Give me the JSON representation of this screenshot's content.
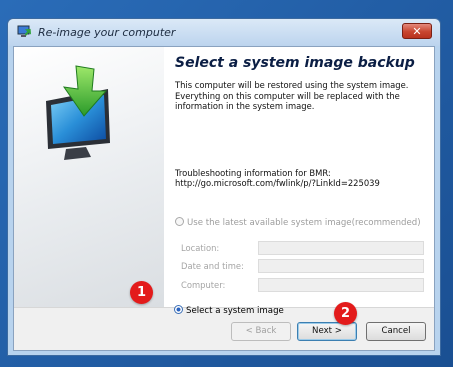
{
  "window": {
    "title": "Re-image your computer",
    "close_glyph": "✕"
  },
  "content": {
    "heading": "Select a system image backup",
    "description": "This computer will be restored using the system image. Everything on this computer will be replaced with the information in the system image.",
    "troubleshoot_line1": "Troubleshooting information for BMR:",
    "troubleshoot_line2": "http://go.microsoft.com/fwlink/p/?LinkId=225039",
    "option_latest": "Use the latest available system image(recommended)",
    "option_latest_selected": false,
    "option_latest_enabled": false,
    "fields": [
      {
        "label": "Location:",
        "value": ""
      },
      {
        "label": "Date and time:",
        "value": ""
      },
      {
        "label": "Computer:",
        "value": ""
      }
    ],
    "option_select": "Select a system image",
    "option_select_selected": true
  },
  "buttons": {
    "back": "< Back",
    "next": "Next >",
    "cancel": "Cancel",
    "back_enabled": false
  },
  "annotations": {
    "step1": "1",
    "step2": "2"
  },
  "colors": {
    "desktop": "#1f5fa8",
    "badge": "#e31b1b",
    "heading": "#0b1e44"
  },
  "icons": {
    "title": "system-restore-icon",
    "illustration": "monitor-restore-arrow-icon"
  }
}
